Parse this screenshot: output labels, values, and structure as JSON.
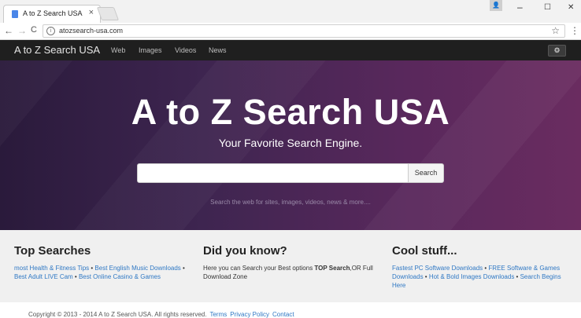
{
  "browser": {
    "tab_title": "A to Z Search USA",
    "tab_close": "×",
    "url": "atozsearch-usa.com",
    "back": "←",
    "forward": "→",
    "reload": "C",
    "info": "i",
    "star": "☆",
    "menu": "⋮",
    "window_min": "–",
    "window_max": "☐",
    "window_close": "✕"
  },
  "navbar": {
    "brand": "A to Z Search USA",
    "links": [
      "Web",
      "Images",
      "Videos",
      "News"
    ],
    "gear": "⚙"
  },
  "hero": {
    "title": "A to Z Search USA",
    "subtitle": "Your Favorite Search Engine.",
    "search_button": "Search",
    "search_value": "",
    "hint": "Search the web for sites, images, videos, news & more...."
  },
  "sections": {
    "top_searches": {
      "heading": "Top Searches",
      "links": [
        "most Health & Fitness Tips",
        "Best English Music Downloads",
        "Best Adult LIVE Cam",
        "Best Online Casino & Games"
      ]
    },
    "did_you_know": {
      "heading": "Did you know?",
      "text_before": "Here you can Search your Best options ",
      "bold": "TOP Search",
      "text_after": ",OR Full Download Zone"
    },
    "cool_stuff": {
      "heading": "Cool stuff...",
      "links": [
        "Fastest PC Software Downloads",
        "FREE Software & Games Downloads",
        "Hot & Bold Images Downloads",
        "Search Begins Here"
      ]
    }
  },
  "footer": {
    "copyright": "Copyright © 2013 - 2014 A to Z Search USA. All rights reserved.",
    "links": [
      "Terms",
      "Privacy Policy",
      "Contact"
    ]
  },
  "colors": {
    "link": "#2f78c4",
    "navbar_bg": "#1f1f1f",
    "hero_start": "#2a1a3b",
    "hero_end": "#6a2c60"
  }
}
